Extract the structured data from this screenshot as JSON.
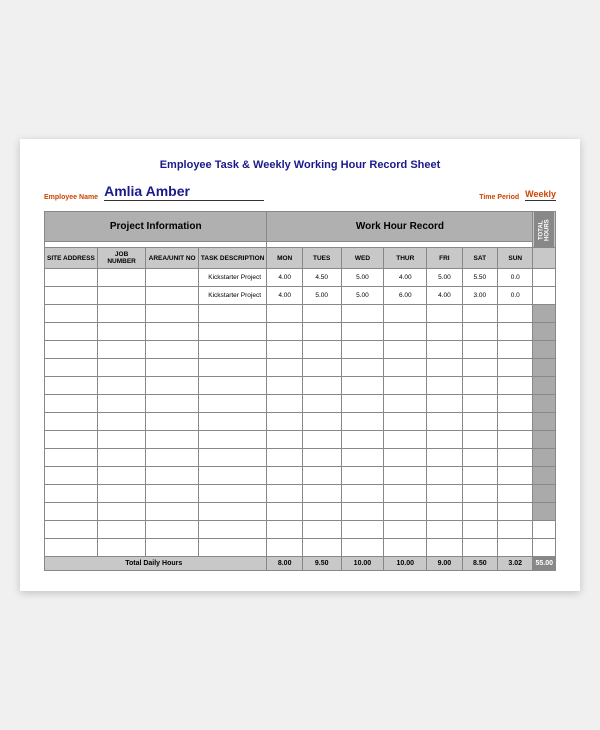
{
  "title": "Employee Task & Weekly Working Hour Record Sheet",
  "employee": {
    "label": "Employee Name",
    "name": "Amlia Amber"
  },
  "time_period": {
    "label": "Time Period",
    "value": "Weekly"
  },
  "section_headers": {
    "project": "Project Information",
    "work": "Work Hour Record"
  },
  "column_headers": {
    "project_cols": [
      "SITE ADDRESS",
      "JOB NUMBER",
      "AREA/UNIT NO",
      "TASK DESCRIPTION"
    ],
    "day_cols": [
      "MON",
      "TUES",
      "WED",
      "THUR",
      "FRI",
      "SAT",
      "SUN"
    ],
    "total": "TOTAL HOURS"
  },
  "data_rows": [
    {
      "site": "",
      "job": "",
      "area": "",
      "task": "Kickstarter Project",
      "mon": "4.00",
      "tue": "4.50",
      "wed": "5.00",
      "thur": "4.00",
      "fri": "5.00",
      "sat": "5.50",
      "sun": "0.0"
    },
    {
      "site": "",
      "job": "",
      "area": "",
      "task": "Kickstarter Project",
      "mon": "4.00",
      "tue": "5.00",
      "wed": "5.00",
      "thur": "6.00",
      "fri": "4.00",
      "sat": "3.00",
      "sun": "0.0"
    }
  ],
  "totals": {
    "label": "Total Daily Hours",
    "values": [
      "8.00",
      "9.50",
      "10.00",
      "10.00",
      "9.00",
      "8.50",
      "3.02",
      "55.00"
    ]
  },
  "empty_rows": 14
}
